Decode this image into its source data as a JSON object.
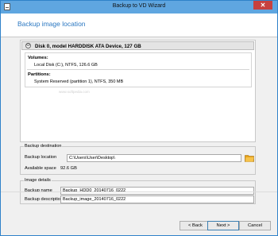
{
  "window": {
    "title": "Backup to VD Wizard",
    "close_symbol": "✕"
  },
  "header": {
    "title": "Backup image location"
  },
  "disk": {
    "collapse_symbol": "⊖",
    "name": "Disk 0, model HARDDISK ATA Device, 127 GB",
    "volumes_label": "Volumes:",
    "volumes": [
      "Local Disk (C:), NTFS, 126.6 GB"
    ],
    "partitions_label": "Partitions:",
    "partitions": [
      "System Reserved (partition 1), NTFS, 350 MB"
    ],
    "watermark": "www.softpedia.com"
  },
  "backup_destination": {
    "group_label": "Backup destination",
    "location_label": "Backup location",
    "location_value": "C:\\Users\\User\\Desktop\\",
    "available_label": "Available space",
    "available_value": "92.6 GB"
  },
  "image_details": {
    "group_label": "Image details",
    "name_label": "Backup name",
    "name_value": "Backup_HDD0_20140716_0222",
    "description_label": "Backup description",
    "description_value": "Backup_image_20140716_0222"
  },
  "footer": {
    "back_label": "< Back",
    "next_label": "Next >",
    "cancel_label": "Cancel"
  },
  "colors": {
    "titlebar": "#5fa6e0",
    "close": "#c7413f",
    "header_title": "#2a77c1",
    "folder": "#e6a21a"
  }
}
